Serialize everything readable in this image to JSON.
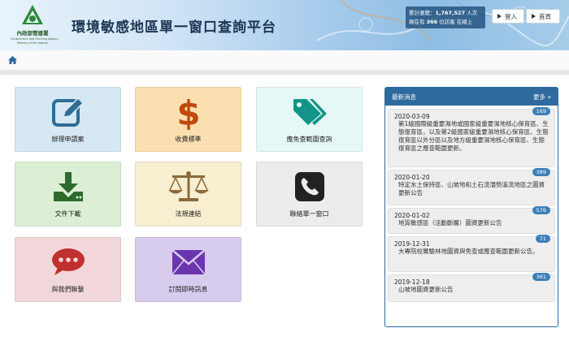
{
  "header": {
    "title": "環境敏感地區單一窗口查詢平台",
    "logo": {
      "name": "內政部營建署",
      "en1": "Construction and Planning Agency",
      "en2": "Ministry of the Interior"
    },
    "stats": {
      "line1_prefix": "累計瀏覽：",
      "total": "1,767,527",
      "line1_suffix": " 人次",
      "line2_prefix": "現在有 ",
      "online": "366",
      "line2_suffix": " 位訪客 在線上"
    },
    "login_label": "登入",
    "home_label": "首頁"
  },
  "tiles": [
    {
      "label": "辦理申請案",
      "icon": "edit-icon",
      "color": "#2f6d94"
    },
    {
      "label": "收費標準",
      "icon": "dollar-icon",
      "color": "#c1480e"
    },
    {
      "label": "應免查範圍查詢",
      "icon": "tags-icon",
      "color": "#129488"
    },
    {
      "label": "文件下載",
      "icon": "download-icon",
      "color": "#2d6b2d"
    },
    {
      "label": "法規連結",
      "icon": "balance-scale-icon",
      "color": "#8a6a3a"
    },
    {
      "label": "聯絡單一窗口",
      "icon": "phone-icon",
      "color": "#222222"
    },
    {
      "label": "與我們聯繫",
      "icon": "chat-icon",
      "color": "#c0302e"
    },
    {
      "label": "訂閱即時訊息",
      "icon": "envelope-icon",
      "color": "#6b35b0"
    }
  ],
  "news": {
    "title": "最新消息",
    "more_label": "更多 »",
    "items": [
      {
        "date": "2020-03-09",
        "count": "169",
        "text": "第1級國際級重要濕地或國家級重要濕地核心保育區、生態復育區，以及第2級國家級重要濕地核心保育區、生態復育區以外分區以及地方級重要濕地核心保育區、生態復育區之應查範圍更新。"
      },
      {
        "date": "2020-01-20",
        "count": "389",
        "text": "特定水土保持區、山坡地和土石流潛勢溪流地區之圖資更新公告"
      },
      {
        "date": "2020-01-02",
        "count": "576",
        "text": "地質敏感區（活動斷層）圖資更新公告"
      },
      {
        "date": "2019-12-31",
        "count": "71",
        "text": "大專院校實驗林地圖資與免查或應查範圍更新公告。"
      },
      {
        "date": "2019-12-18",
        "count": "361",
        "text": "山坡地圖資更新公告"
      }
    ]
  }
}
